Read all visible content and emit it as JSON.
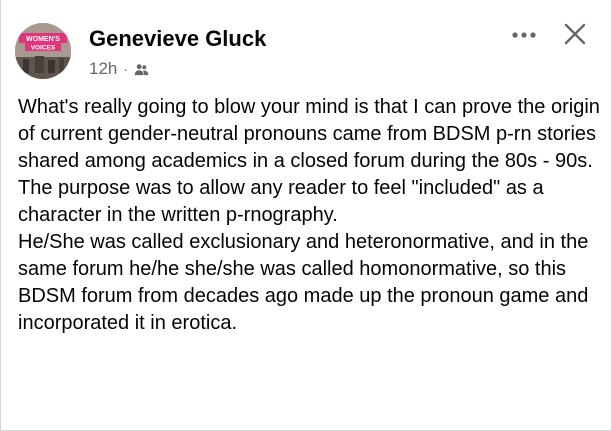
{
  "post": {
    "author": "Genevieve Gluck",
    "timestamp": "12h",
    "separator": "·",
    "audience_icon": "friends-icon",
    "avatar_text_line1": "WOMEN'S",
    "avatar_text_line2": "VOICES",
    "menu_icon": "more-options-icon",
    "close_icon": "close-icon",
    "paragraph1": "What's really going to blow your mind is that I can prove the origin of current gender-neutral pronouns came from BDSM p-rn stories shared among academics in a closed forum during the 80s - 90s. The purpose was to allow any reader to feel \"included\" as a character in the written p-rnography.",
    "paragraph2": "He/She was called exclusionary and heteronormative, and in the same forum he/he she/she was called homonormative, so this BDSM forum from decades ago made up the pronoun game and incorporated it in erotica."
  },
  "colors": {
    "text": "#050505",
    "secondary": "#65676b",
    "logo_pink": "#e0357a"
  }
}
